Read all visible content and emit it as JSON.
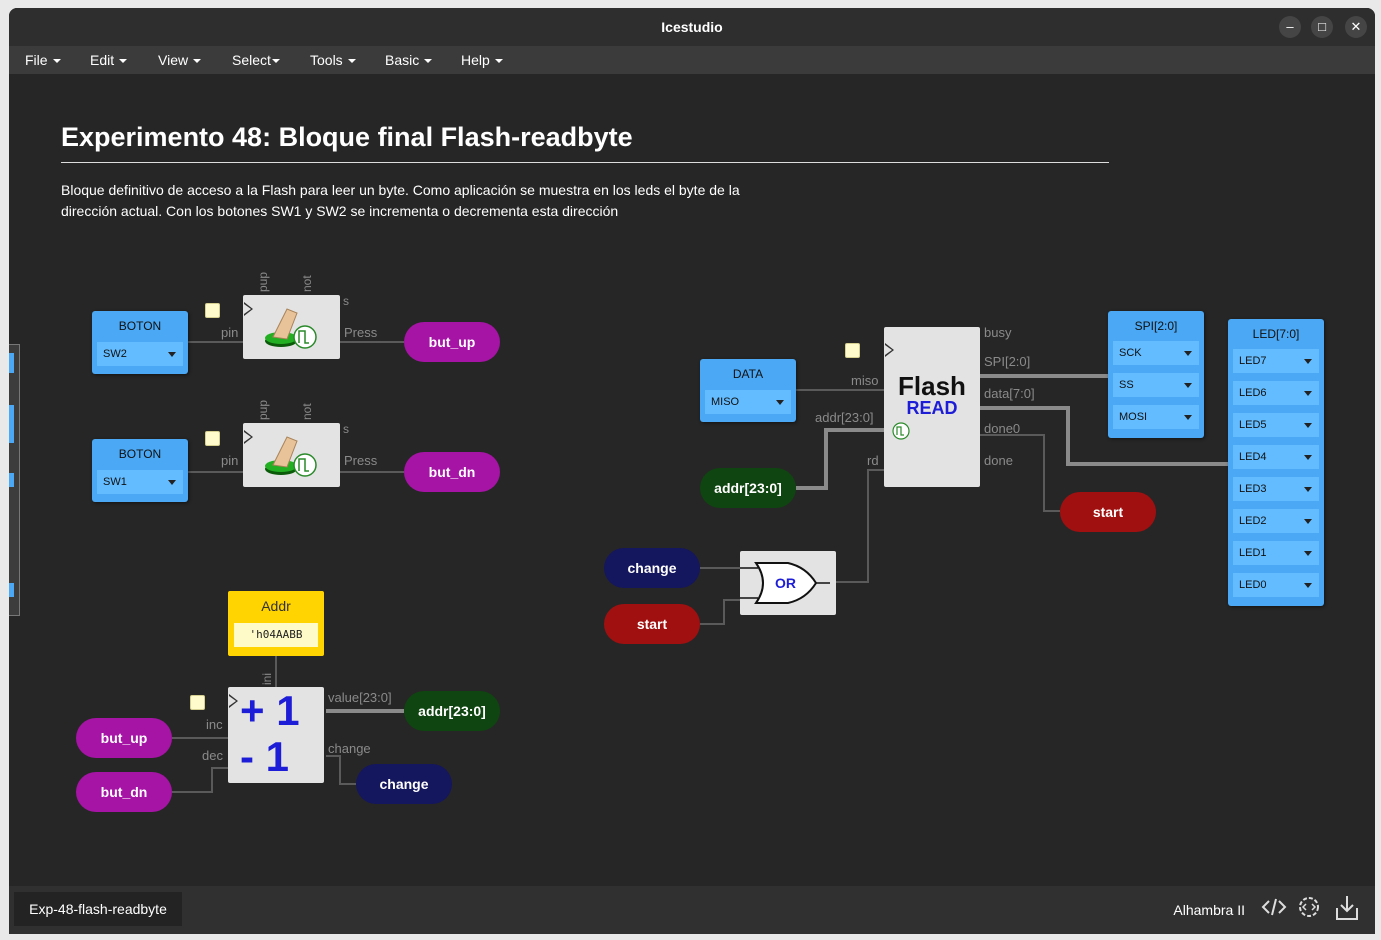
{
  "app": {
    "title": "Icestudio",
    "minimize": "–",
    "maximize": "□",
    "close": "✕"
  },
  "menu": [
    {
      "label": "File"
    },
    {
      "label": "Edit"
    },
    {
      "label": "View"
    },
    {
      "label": "Select"
    },
    {
      "label": "Tools"
    },
    {
      "label": "Basic"
    },
    {
      "label": "Help"
    }
  ],
  "doc": {
    "heading": "Experimento 48: Bloque final Flash-readbyte",
    "description": "Bloque definitivo de acceso a la Flash para leer un byte. Como aplicación se muestra en los leds el byte de la dirección actual. Con los botones SW1 y SW2 se incrementa o decrementa esta dirección"
  },
  "inputs": {
    "boton_up": {
      "label": "BOTON",
      "value": "SW2"
    },
    "boton_dn": {
      "label": "BOTON",
      "value": "SW1"
    },
    "data": {
      "label": "DATA",
      "value": "MISO"
    }
  },
  "button_block": {
    "ports": {
      "pup": "pup",
      "not": "not",
      "s": "s",
      "pin": "pin",
      "press": "Press"
    }
  },
  "pills": {
    "but_up": "but_up",
    "but_dn": "but_dn",
    "addr": "addr[23:0]",
    "change": "change",
    "start": "start"
  },
  "flash": {
    "title": "Flash",
    "subtitle": "READ",
    "ports": {
      "miso": "miso",
      "addr": "addr[23:0]",
      "rd": "rd",
      "busy": "busy",
      "spi": "SPI[2:0]",
      "data": "data[7:0]",
      "done0": "done0",
      "done": "done"
    }
  },
  "or_gate": {
    "label": "OR"
  },
  "spi_out": {
    "label": "SPI[2:0]",
    "items": [
      "SCK",
      "SS",
      "MOSI"
    ]
  },
  "led_out": {
    "label": "LED[7:0]",
    "items": [
      "LED7",
      "LED6",
      "LED5",
      "LED4",
      "LED3",
      "LED2",
      "LED1",
      "LED0"
    ]
  },
  "addr_const": {
    "label": "Addr",
    "value": "'h04AABB"
  },
  "counter": {
    "plus": "+ 1",
    "minus": "- 1",
    "ports": {
      "ini": "ini",
      "inc": "inc",
      "dec": "dec",
      "value": "value[23:0]",
      "change": "change"
    }
  },
  "footer": {
    "file_tab": "Exp-48-flash-readbyte",
    "board": "Alhambra II"
  },
  "colors": {
    "input_block": "#4aa8f4",
    "purple": "#a514a5",
    "green": "#0f4510",
    "navy": "#14165e",
    "red": "#a01010",
    "const": "#ffd400"
  }
}
